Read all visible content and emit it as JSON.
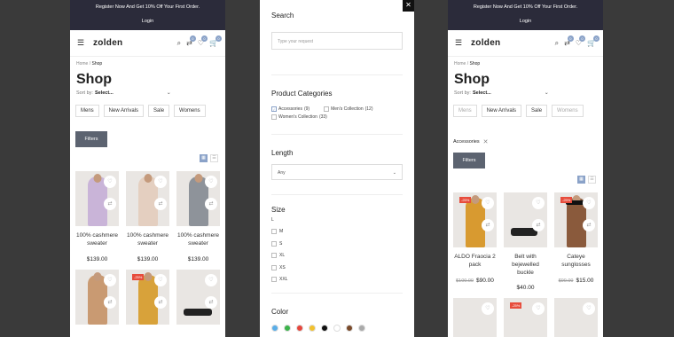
{
  "banner": {
    "text": "Register Now And Get 10% Off Your First Order.",
    "login": "Login"
  },
  "header": {
    "logo": "zolden",
    "compare_count": "0",
    "wishlist_count": "0",
    "cart_count": "0"
  },
  "breadcrumb": {
    "home": "Home",
    "sep": " / ",
    "current": "Shop"
  },
  "page_title": "Shop",
  "sort": {
    "label": "Sort by:",
    "value": "Select..."
  },
  "categories": [
    "Mens",
    "New Arrivals",
    "Sale",
    "Womens"
  ],
  "filters_label": "Filters",
  "left_products": [
    {
      "name": "100% cashmere sweater",
      "price": "$139.00"
    },
    {
      "name": "100% cashmere sweater",
      "price": "$139.00"
    },
    {
      "name": "100% cashmere sweater",
      "price": "$139.00"
    }
  ],
  "sale_badge": "-25%",
  "filter_panel": {
    "search_title": "Search",
    "search_placeholder": "Type your request",
    "categories_title": "Product Categories",
    "category_options": [
      {
        "label": "Accessories",
        "count": "(9)",
        "checked": true
      },
      {
        "label": "Men's Collection",
        "count": "(12)",
        "checked": false
      },
      {
        "label": "Women's Collection",
        "count": "(33)",
        "checked": false
      }
    ],
    "length_title": "Length",
    "length_value": "Any",
    "size_title": "Size",
    "sizes": [
      "L",
      "M",
      "S",
      "XL",
      "XS",
      "XXL"
    ],
    "color_title": "Color",
    "colors": [
      "#5aaee8",
      "#3cb44b",
      "#e6463c",
      "#f2c12e",
      "#111111",
      "#ffffff",
      "#7a4a2a",
      "#aaaaaa"
    ]
  },
  "applied_filter": "Accessories",
  "right_products": [
    {
      "name": "ALDO Fraocia 2 pack",
      "old_price": "$100.00",
      "price": "$90.00",
      "sale": true
    },
    {
      "name": "Belt with bejewelled buckle",
      "old_price": "",
      "price": "$40.00",
      "sale": false
    },
    {
      "name": "Cateye sunglosses",
      "old_price": "$90.00",
      "price": "$15.00",
      "sale": true
    }
  ]
}
